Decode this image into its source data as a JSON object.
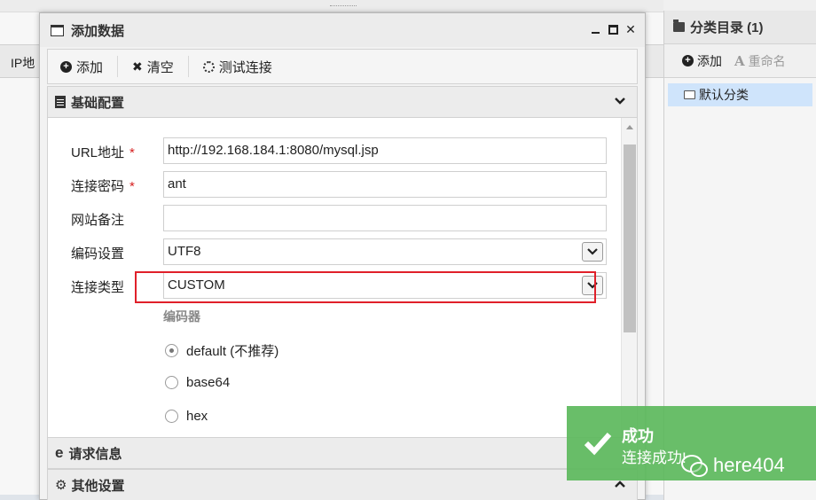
{
  "background": {
    "header_col": "IP地"
  },
  "right_panel": {
    "title": "分类目录 (1)",
    "add_label": "添加",
    "rename_label": "重命名",
    "tree": [
      {
        "label": "默认分类"
      }
    ]
  },
  "dialog": {
    "title": "添加数据",
    "toolbar": {
      "add_label": "添加",
      "clear_label": "清空",
      "test_label": "测试连接"
    },
    "sections": {
      "basic": "基础配置",
      "request": "请求信息",
      "other": "其他设置"
    },
    "form": {
      "url": {
        "label": "URL地址",
        "required": "*",
        "value": "http://192.168.184.1:8080/mysql.jsp"
      },
      "password": {
        "label": "连接密码",
        "required": "*",
        "value": "ant"
      },
      "note": {
        "label": "网站备注",
        "value": ""
      },
      "encoding": {
        "label": "编码设置",
        "value": "UTF8"
      },
      "conn_type": {
        "label": "连接类型",
        "value": "CUSTOM"
      },
      "encoder_label": "编码器",
      "encoders": [
        {
          "label": "default (不推荐)",
          "selected": true
        },
        {
          "label": "base64",
          "selected": false
        },
        {
          "label": "hex",
          "selected": false
        }
      ]
    }
  },
  "toast": {
    "title": "成功",
    "message": "连接成功!",
    "color": "#5cb85c"
  },
  "watermark": {
    "text": "here404"
  },
  "colors": {
    "highlight": "#e0202a",
    "required": "#d62020",
    "tree_selected": "#cfe4fb"
  }
}
